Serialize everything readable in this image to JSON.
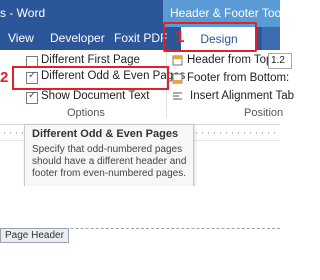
{
  "titlebar": {
    "title": "s - Word",
    "context_label": "Header & Footer Tools"
  },
  "tabs": [
    {
      "label": "View"
    },
    {
      "label": "Developer"
    },
    {
      "label": "Foxit PDF"
    },
    {
      "label": "Design"
    }
  ],
  "options": {
    "group_label": "Options",
    "items": [
      {
        "label": "Different First Page",
        "checked": false
      },
      {
        "label": "Different Odd & Even Pages",
        "checked": true
      },
      {
        "label": "Show Document Text",
        "checked": true
      }
    ]
  },
  "position": {
    "group_label": "Position",
    "header_from_top_label": "Header from Top:",
    "header_from_top_value": "1.2",
    "footer_from_bottom_label": "Footer from Bottom:",
    "insert_alignment_label": "Insert Alignment Tab"
  },
  "annotations": {
    "step1": "1",
    "step2": "2"
  },
  "tooltip": {
    "title": "Different Odd & Even Pages",
    "body": "Specify that odd-numbered pages should have a different header and footer from even-numbered pages."
  },
  "document": {
    "header_tag": "Page Header"
  },
  "colors": {
    "ribbon_blue": "#2b579a",
    "context_blue": "#5b9bd5",
    "highlight_red": "#e22127"
  }
}
